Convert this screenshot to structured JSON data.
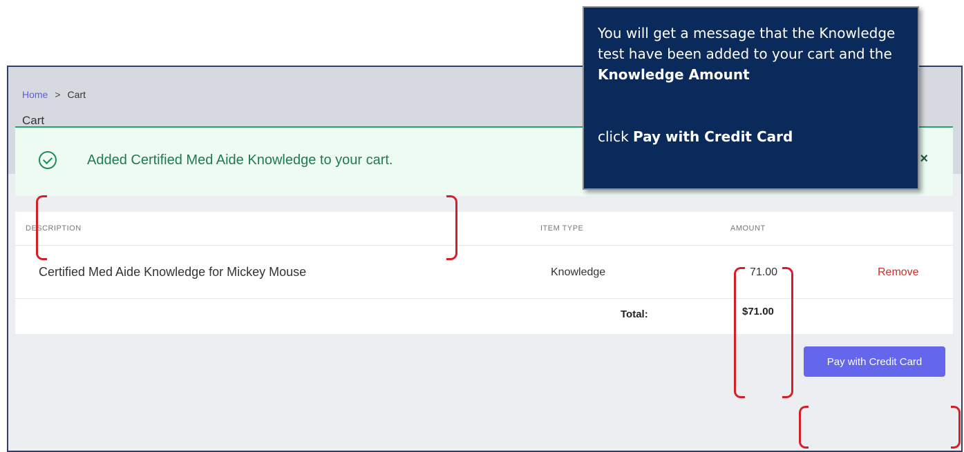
{
  "breadcrumb": {
    "home": "Home",
    "separator": ">",
    "current": "Cart"
  },
  "page_title": "Cart",
  "alert": {
    "message": "Added Certified Med Aide Knowledge to your cart.",
    "close_symbol": "×",
    "icon": "check-circle-icon"
  },
  "table": {
    "headers": [
      "DESCRIPTION",
      "ITEM TYPE",
      "AMOUNT"
    ],
    "rows": [
      {
        "description": "Certified Med Aide Knowledge for Mickey Mouse",
        "item_type": "Knowledge",
        "amount": "71.00",
        "action": "Remove"
      }
    ],
    "total_label": "Total:",
    "total_amount": "$71.00"
  },
  "pay_button": "Pay with Credit Card",
  "callout": {
    "line1": "You will get a message that the Knowledge test have been added to your cart",
    "line1_suffix": " and the",
    "line2": "Knowledge Amount",
    "line3_prefix": "click ",
    "line3_bold": "Pay with Credit Card"
  },
  "colors": {
    "accent": "#6466ec",
    "success": "#1f8a5b",
    "danger": "#c9302c",
    "callout_bg": "#0b2a5c",
    "annotation": "#d51f27"
  }
}
